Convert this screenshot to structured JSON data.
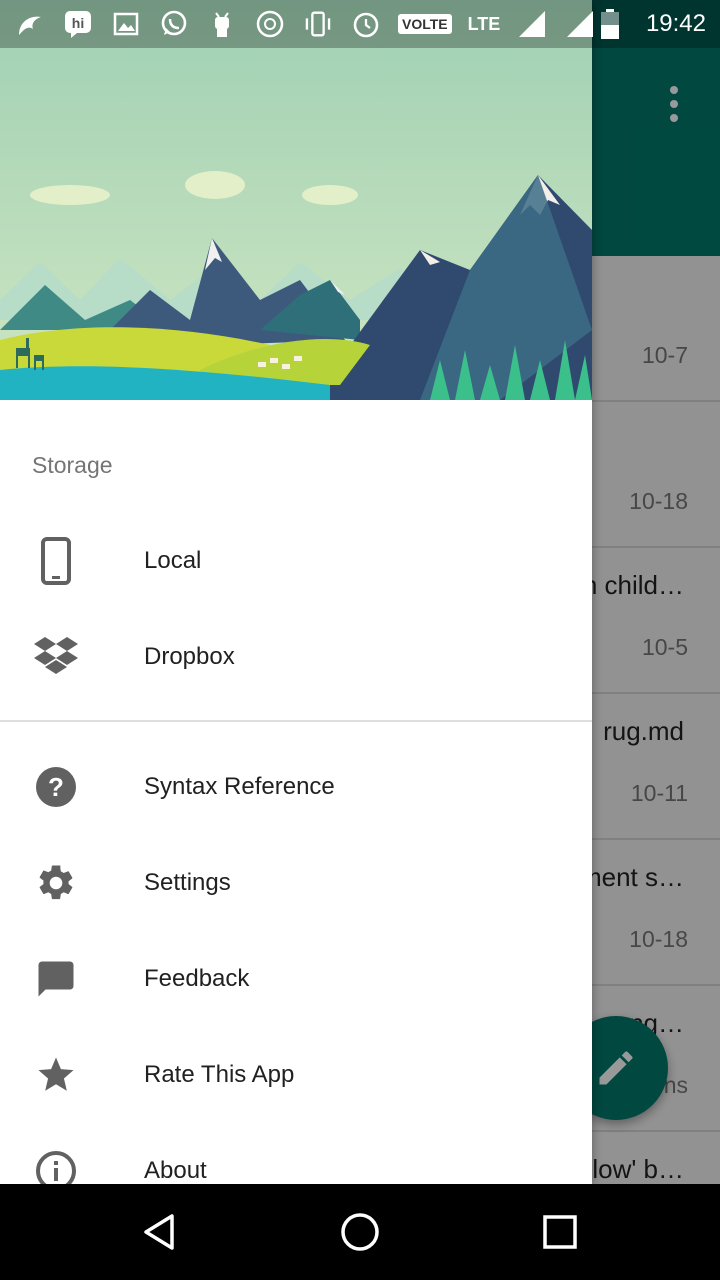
{
  "status_bar": {
    "time": "19:42",
    "volte": "VOLTE",
    "network": "LTE",
    "icons": [
      "uc-browser-icon",
      "hike-icon",
      "gallery-icon",
      "whatsapp-icon",
      "android-debug-icon",
      "wifi-hotspot-icon",
      "vibrate-icon",
      "alarm-icon",
      "volte-icon",
      "lte-icon",
      "signal-icon",
      "signal-icon",
      "battery-icon"
    ]
  },
  "background_list": {
    "items": [
      {
        "title": "",
        "date": "10-7"
      },
      {
        "title": "",
        "date": "10-18"
      },
      {
        "title": "n child…",
        "date": "10-5"
      },
      {
        "title": "rug.md",
        "date": "10-11"
      },
      {
        "title": "ment s…",
        "date": "10-18"
      },
      {
        "title": "ng…",
        "date": "ns"
      },
      {
        "title": "low' b…",
        "date": ""
      }
    ]
  },
  "drawer": {
    "section_label": "Storage",
    "storage_items": [
      {
        "label": "Local",
        "icon": "phone-icon"
      },
      {
        "label": "Dropbox",
        "icon": "dropbox-icon"
      }
    ],
    "menu_items": [
      {
        "label": "Syntax Reference",
        "icon": "help-icon"
      },
      {
        "label": "Settings",
        "icon": "gear-icon"
      },
      {
        "label": "Feedback",
        "icon": "feedback-icon"
      },
      {
        "label": "Rate This App",
        "icon": "star-icon"
      },
      {
        "label": "About",
        "icon": "info-icon"
      }
    ]
  },
  "colors": {
    "accent": "#00796b",
    "icon_gray": "#616161"
  }
}
